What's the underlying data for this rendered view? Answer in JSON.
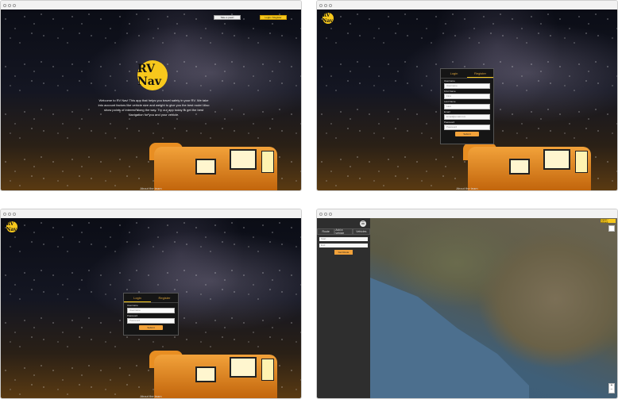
{
  "screens": {
    "landing": {
      "top_buttons": [
        "Take a peek!",
        "Login / Register"
      ],
      "welcome_text": "Welcome to RV Nav! This app that helps you travel safely in your RV. We take into account factors like vehicle size and weight to give you the best route! Also show points of interest along the way. Try our app today to get the best Navigation for you and your vehicle.",
      "footer": "About the team"
    },
    "register": {
      "tabs": [
        "Login",
        "Register"
      ],
      "fields": [
        {
          "label": "Username",
          "placeholder": "Username"
        },
        {
          "label": "First Name",
          "placeholder": "First"
        },
        {
          "label": "Last Name",
          "placeholder": "Last"
        },
        {
          "label": "Email",
          "placeholder": "Email@email.com"
        },
        {
          "label": "Password",
          "placeholder": "Password"
        }
      ],
      "submit": "Submit",
      "footer": "About the team"
    },
    "login": {
      "tabs": [
        "Login",
        "Register"
      ],
      "fields": [
        {
          "label": "Username",
          "placeholder": "Username"
        },
        {
          "label": "Password",
          "placeholder": "Password"
        }
      ],
      "submit": "Submit",
      "footer": "About the team"
    },
    "map": {
      "tabs": [
        "Route",
        "Add a vehicle",
        "Vehicles"
      ],
      "inputs": [
        "Start",
        "End"
      ],
      "button": "Get Route",
      "top_right": "Logout / Account"
    }
  },
  "logo_text": "RV Nav"
}
